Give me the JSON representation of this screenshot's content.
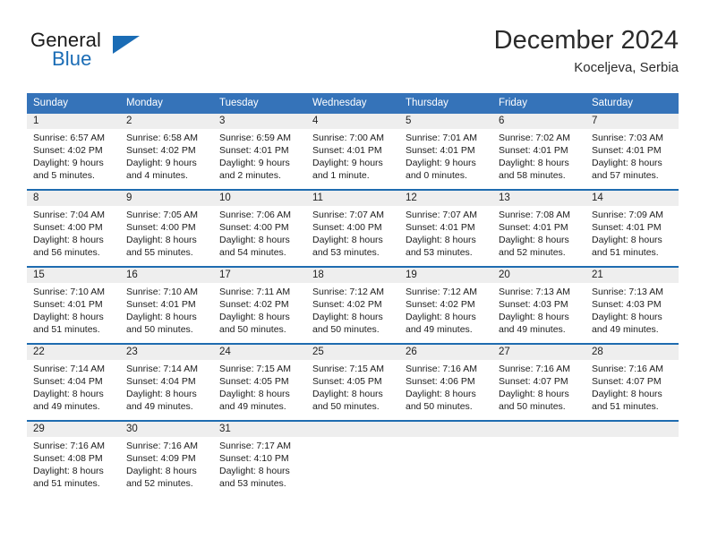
{
  "brand": {
    "name_part1": "General",
    "name_part2": "Blue",
    "flag_icon": "triangle-flag-icon"
  },
  "header": {
    "month_title": "December 2024",
    "location": "Koceljeva, Serbia"
  },
  "colors": {
    "header_blue": "#3573b9",
    "separator_blue": "#1f6cb0",
    "daynum_band": "#eeeeee",
    "brand_blue": "#1a6cb5",
    "text": "#1c1c1c"
  },
  "weekday_headers": [
    "Sunday",
    "Monday",
    "Tuesday",
    "Wednesday",
    "Thursday",
    "Friday",
    "Saturday"
  ],
  "weeks": [
    [
      {
        "day": "1",
        "sunrise": "Sunrise: 6:57 AM",
        "sunset": "Sunset: 4:02 PM",
        "daylight_line1": "Daylight: 9 hours",
        "daylight_line2": "and 5 minutes."
      },
      {
        "day": "2",
        "sunrise": "Sunrise: 6:58 AM",
        "sunset": "Sunset: 4:02 PM",
        "daylight_line1": "Daylight: 9 hours",
        "daylight_line2": "and 4 minutes."
      },
      {
        "day": "3",
        "sunrise": "Sunrise: 6:59 AM",
        "sunset": "Sunset: 4:01 PM",
        "daylight_line1": "Daylight: 9 hours",
        "daylight_line2": "and 2 minutes."
      },
      {
        "day": "4",
        "sunrise": "Sunrise: 7:00 AM",
        "sunset": "Sunset: 4:01 PM",
        "daylight_line1": "Daylight: 9 hours",
        "daylight_line2": "and 1 minute."
      },
      {
        "day": "5",
        "sunrise": "Sunrise: 7:01 AM",
        "sunset": "Sunset: 4:01 PM",
        "daylight_line1": "Daylight: 9 hours",
        "daylight_line2": "and 0 minutes."
      },
      {
        "day": "6",
        "sunrise": "Sunrise: 7:02 AM",
        "sunset": "Sunset: 4:01 PM",
        "daylight_line1": "Daylight: 8 hours",
        "daylight_line2": "and 58 minutes."
      },
      {
        "day": "7",
        "sunrise": "Sunrise: 7:03 AM",
        "sunset": "Sunset: 4:01 PM",
        "daylight_line1": "Daylight: 8 hours",
        "daylight_line2": "and 57 minutes."
      }
    ],
    [
      {
        "day": "8",
        "sunrise": "Sunrise: 7:04 AM",
        "sunset": "Sunset: 4:00 PM",
        "daylight_line1": "Daylight: 8 hours",
        "daylight_line2": "and 56 minutes."
      },
      {
        "day": "9",
        "sunrise": "Sunrise: 7:05 AM",
        "sunset": "Sunset: 4:00 PM",
        "daylight_line1": "Daylight: 8 hours",
        "daylight_line2": "and 55 minutes."
      },
      {
        "day": "10",
        "sunrise": "Sunrise: 7:06 AM",
        "sunset": "Sunset: 4:00 PM",
        "daylight_line1": "Daylight: 8 hours",
        "daylight_line2": "and 54 minutes."
      },
      {
        "day": "11",
        "sunrise": "Sunrise: 7:07 AM",
        "sunset": "Sunset: 4:00 PM",
        "daylight_line1": "Daylight: 8 hours",
        "daylight_line2": "and 53 minutes."
      },
      {
        "day": "12",
        "sunrise": "Sunrise: 7:07 AM",
        "sunset": "Sunset: 4:01 PM",
        "daylight_line1": "Daylight: 8 hours",
        "daylight_line2": "and 53 minutes."
      },
      {
        "day": "13",
        "sunrise": "Sunrise: 7:08 AM",
        "sunset": "Sunset: 4:01 PM",
        "daylight_line1": "Daylight: 8 hours",
        "daylight_line2": "and 52 minutes."
      },
      {
        "day": "14",
        "sunrise": "Sunrise: 7:09 AM",
        "sunset": "Sunset: 4:01 PM",
        "daylight_line1": "Daylight: 8 hours",
        "daylight_line2": "and 51 minutes."
      }
    ],
    [
      {
        "day": "15",
        "sunrise": "Sunrise: 7:10 AM",
        "sunset": "Sunset: 4:01 PM",
        "daylight_line1": "Daylight: 8 hours",
        "daylight_line2": "and 51 minutes."
      },
      {
        "day": "16",
        "sunrise": "Sunrise: 7:10 AM",
        "sunset": "Sunset: 4:01 PM",
        "daylight_line1": "Daylight: 8 hours",
        "daylight_line2": "and 50 minutes."
      },
      {
        "day": "17",
        "sunrise": "Sunrise: 7:11 AM",
        "sunset": "Sunset: 4:02 PM",
        "daylight_line1": "Daylight: 8 hours",
        "daylight_line2": "and 50 minutes."
      },
      {
        "day": "18",
        "sunrise": "Sunrise: 7:12 AM",
        "sunset": "Sunset: 4:02 PM",
        "daylight_line1": "Daylight: 8 hours",
        "daylight_line2": "and 50 minutes."
      },
      {
        "day": "19",
        "sunrise": "Sunrise: 7:12 AM",
        "sunset": "Sunset: 4:02 PM",
        "daylight_line1": "Daylight: 8 hours",
        "daylight_line2": "and 49 minutes."
      },
      {
        "day": "20",
        "sunrise": "Sunrise: 7:13 AM",
        "sunset": "Sunset: 4:03 PM",
        "daylight_line1": "Daylight: 8 hours",
        "daylight_line2": "and 49 minutes."
      },
      {
        "day": "21",
        "sunrise": "Sunrise: 7:13 AM",
        "sunset": "Sunset: 4:03 PM",
        "daylight_line1": "Daylight: 8 hours",
        "daylight_line2": "and 49 minutes."
      }
    ],
    [
      {
        "day": "22",
        "sunrise": "Sunrise: 7:14 AM",
        "sunset": "Sunset: 4:04 PM",
        "daylight_line1": "Daylight: 8 hours",
        "daylight_line2": "and 49 minutes."
      },
      {
        "day": "23",
        "sunrise": "Sunrise: 7:14 AM",
        "sunset": "Sunset: 4:04 PM",
        "daylight_line1": "Daylight: 8 hours",
        "daylight_line2": "and 49 minutes."
      },
      {
        "day": "24",
        "sunrise": "Sunrise: 7:15 AM",
        "sunset": "Sunset: 4:05 PM",
        "daylight_line1": "Daylight: 8 hours",
        "daylight_line2": "and 49 minutes."
      },
      {
        "day": "25",
        "sunrise": "Sunrise: 7:15 AM",
        "sunset": "Sunset: 4:05 PM",
        "daylight_line1": "Daylight: 8 hours",
        "daylight_line2": "and 50 minutes."
      },
      {
        "day": "26",
        "sunrise": "Sunrise: 7:16 AM",
        "sunset": "Sunset: 4:06 PM",
        "daylight_line1": "Daylight: 8 hours",
        "daylight_line2": "and 50 minutes."
      },
      {
        "day": "27",
        "sunrise": "Sunrise: 7:16 AM",
        "sunset": "Sunset: 4:07 PM",
        "daylight_line1": "Daylight: 8 hours",
        "daylight_line2": "and 50 minutes."
      },
      {
        "day": "28",
        "sunrise": "Sunrise: 7:16 AM",
        "sunset": "Sunset: 4:07 PM",
        "daylight_line1": "Daylight: 8 hours",
        "daylight_line2": "and 51 minutes."
      }
    ],
    [
      {
        "day": "29",
        "sunrise": "Sunrise: 7:16 AM",
        "sunset": "Sunset: 4:08 PM",
        "daylight_line1": "Daylight: 8 hours",
        "daylight_line2": "and 51 minutes."
      },
      {
        "day": "30",
        "sunrise": "Sunrise: 7:16 AM",
        "sunset": "Sunset: 4:09 PM",
        "daylight_line1": "Daylight: 8 hours",
        "daylight_line2": "and 52 minutes."
      },
      {
        "day": "31",
        "sunrise": "Sunrise: 7:17 AM",
        "sunset": "Sunset: 4:10 PM",
        "daylight_line1": "Daylight: 8 hours",
        "daylight_line2": "and 53 minutes."
      },
      {
        "day": "",
        "sunrise": "",
        "sunset": "",
        "daylight_line1": "",
        "daylight_line2": ""
      },
      {
        "day": "",
        "sunrise": "",
        "sunset": "",
        "daylight_line1": "",
        "daylight_line2": ""
      },
      {
        "day": "",
        "sunrise": "",
        "sunset": "",
        "daylight_line1": "",
        "daylight_line2": ""
      },
      {
        "day": "",
        "sunrise": "",
        "sunset": "",
        "daylight_line1": "",
        "daylight_line2": ""
      }
    ]
  ]
}
